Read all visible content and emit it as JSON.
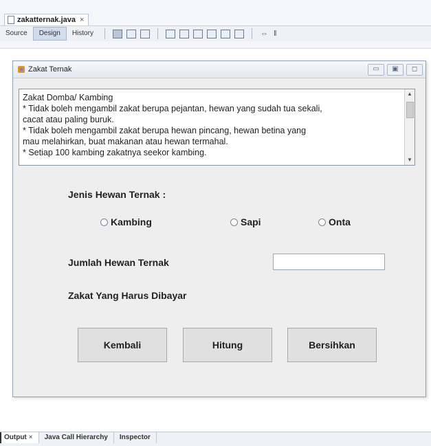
{
  "ide": {
    "file_tab": "zakatternak.java",
    "close_glyph": "×",
    "views": {
      "source": "Source",
      "design": "Design",
      "history": "History"
    },
    "toolbar_glyphs": {
      "link": "⇔",
      "marker": "‖"
    }
  },
  "form": {
    "title": "Zakat Ternak",
    "window_buttons": [
      "▭",
      "▣",
      "◻"
    ],
    "info_lines": [
      "Zakat Domba/ Kambing",
      "* Tidak boleh mengambil zakat berupa pejantan, hewan yang sudah tua sekali,",
      "cacat atau paling buruk.",
      "* Tidak boleh mengambil zakat berupa hewan pincang, hewan betina yang",
      "mau melahirkan, buat makanan atau hewan termahal.",
      "* Setiap 100 kambing zakatnya seekor kambing."
    ],
    "jenis_label": "Jenis Hewan Ternak :",
    "radios": {
      "kambing": "Kambing",
      "sapi": "Sapi",
      "onta": "Onta"
    },
    "jumlah_label": "Jumlah Hewan Ternak",
    "jumlah_value": "",
    "zakat_label": "Zakat Yang Harus Dibayar",
    "buttons": {
      "kembali": "Kembali",
      "hitung": "Hitung",
      "bersihkan": "Bersihkan"
    }
  },
  "bottom_tabs": {
    "output": "Output",
    "call_hierarchy": "Java Call Hierarchy",
    "inspector": "Inspector"
  }
}
